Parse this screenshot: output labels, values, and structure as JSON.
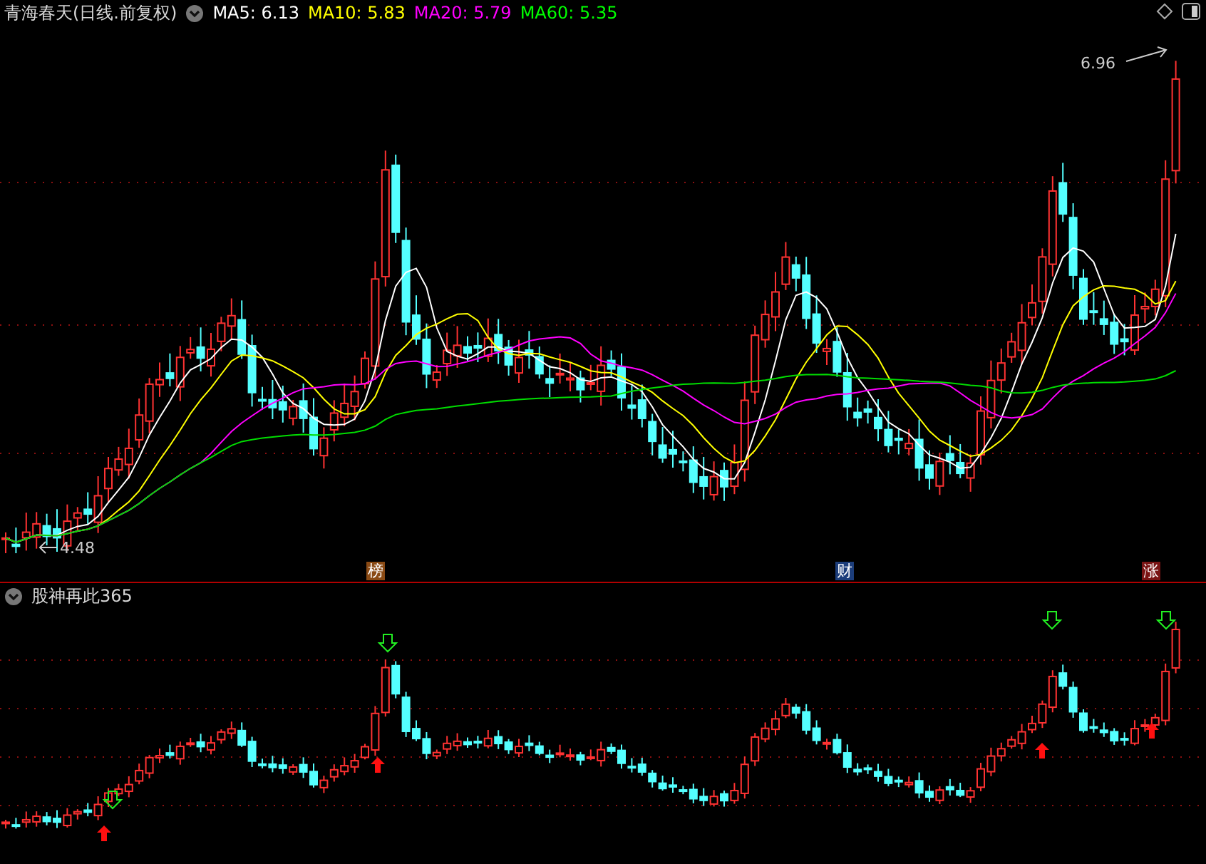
{
  "main_panel": {
    "title": "青海春天(日线.前复权)",
    "indicators": [
      {
        "label": "MA5: 6.13",
        "color": "#ffffff"
      },
      {
        "label": "MA10: 5.83",
        "color": "#ffff00"
      },
      {
        "label": "MA20: 5.79",
        "color": "#ff00ff"
      },
      {
        "label": "MA60: 5.35",
        "color": "#00ff00"
      }
    ],
    "high_label": "6.96",
    "low_label": "4.48",
    "markers": [
      {
        "label": "榜",
        "color": "#8a4a14"
      },
      {
        "label": "财",
        "color": "#1c3d7a"
      },
      {
        "label": "涨",
        "color": "#7a1414"
      }
    ]
  },
  "sub_panel": {
    "title": "股神再此365"
  }
}
